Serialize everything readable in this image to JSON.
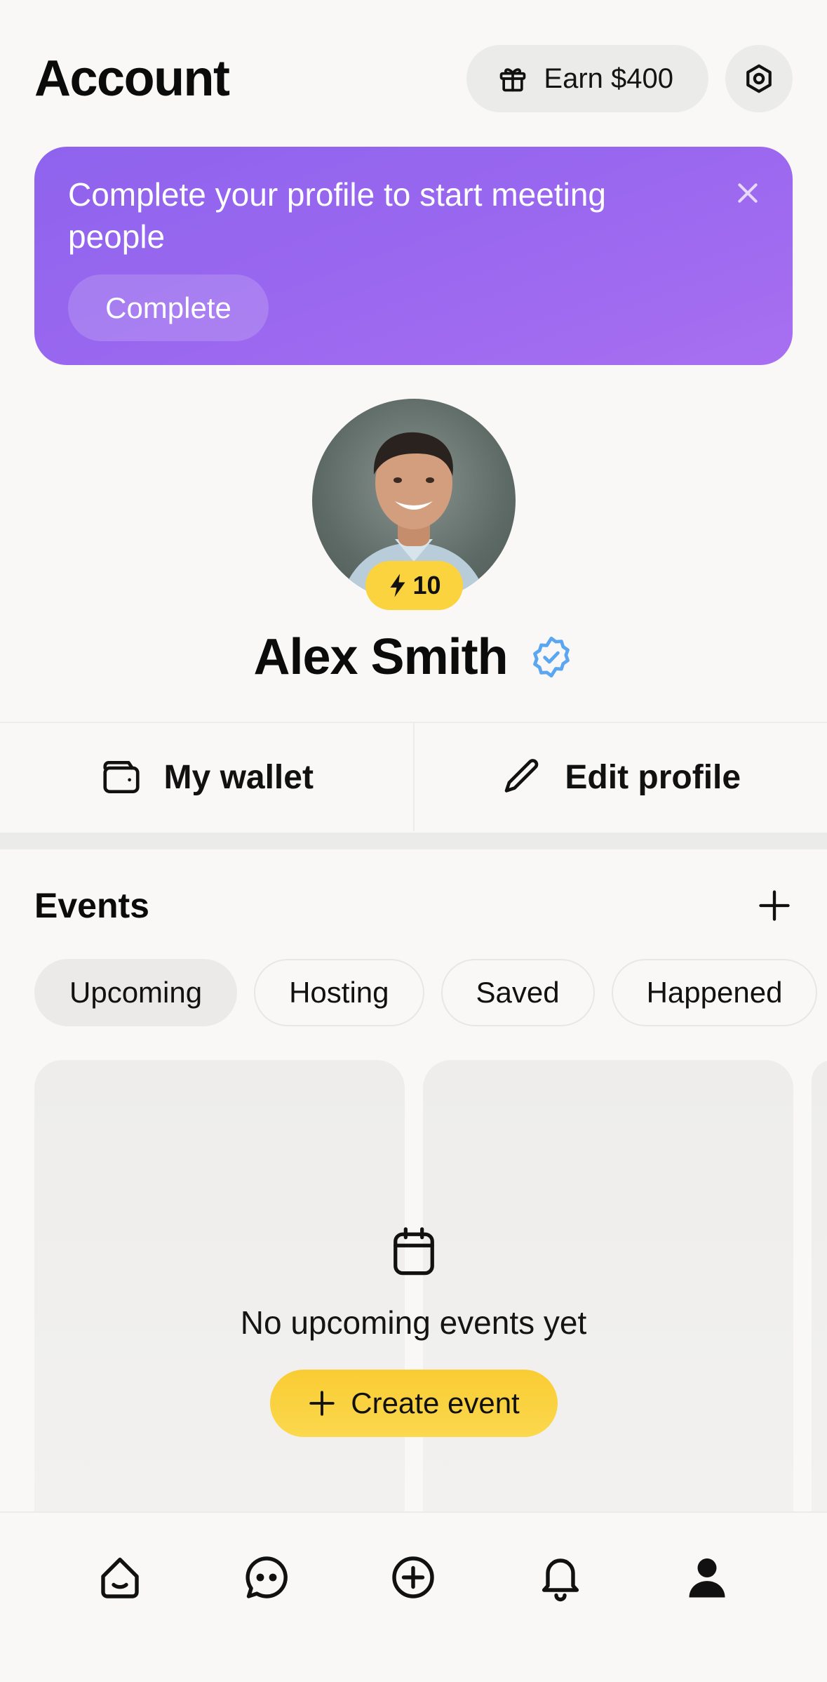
{
  "header": {
    "title": "Account",
    "earn_label": "Earn $400"
  },
  "promo": {
    "text": "Complete your profile to start meeting people",
    "button_label": "Complete"
  },
  "profile": {
    "score": "10",
    "name": "Alex Smith"
  },
  "actions": {
    "wallet_label": "My wallet",
    "edit_label": "Edit profile"
  },
  "events": {
    "title": "Events",
    "tabs": [
      {
        "label": "Upcoming",
        "active": true
      },
      {
        "label": "Hosting",
        "active": false
      },
      {
        "label": "Saved",
        "active": false
      },
      {
        "label": "Happened",
        "active": false
      }
    ],
    "empty_text": "No upcoming events yet",
    "create_label": "Create event"
  },
  "nav": {
    "items": [
      "home-icon",
      "chat-icon",
      "create-icon",
      "notifications-icon",
      "profile-icon"
    ],
    "active": "profile-icon"
  },
  "colors": {
    "promo_start": "#8f63ee",
    "promo_end": "#a86ff1",
    "accent_yellow": "#fbd33e",
    "verified_blue": "#5aa6f0"
  }
}
